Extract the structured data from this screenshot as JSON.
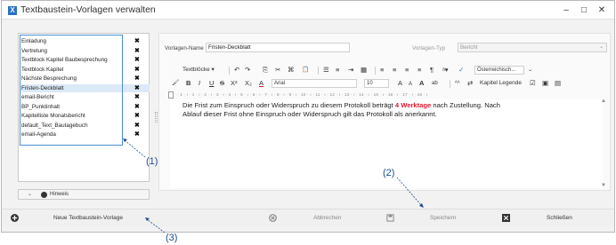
{
  "window": {
    "title": "Textbaustein-Vorlagen verwalten",
    "app_icon_letter": "X",
    "minimize": "–",
    "maximize": "□",
    "close": "✕"
  },
  "templates": {
    "items": [
      {
        "name": "Einladung",
        "delete": "✖"
      },
      {
        "name": "Vertretung",
        "delete": "✖"
      },
      {
        "name": "Textblock Kapitel Baubesprechung",
        "delete": "✖"
      },
      {
        "name": "Textblock Kapitel",
        "delete": "✖"
      },
      {
        "name": "Nächste Besprechung",
        "delete": "✖"
      },
      {
        "name": "Fristen-Deckblatt",
        "delete": "✖"
      },
      {
        "name": "email-Bericht",
        "delete": "✖"
      },
      {
        "name": "BP_Punktinhalt",
        "delete": "✖"
      },
      {
        "name": "Kapitelliste Monatsbericht",
        "delete": "✖"
      },
      {
        "name": "default_Text_Bautagebuch",
        "delete": "✖"
      },
      {
        "name": "email-Agenda",
        "delete": "✖"
      }
    ],
    "selected_index": 5
  },
  "hint": {
    "chevron": "⌄",
    "label": "Hinweis"
  },
  "form": {
    "name_label": "Vorlagen-Name",
    "name_value": "Fristen-Deckblatt",
    "type_label": "Vorlagen-Typ",
    "type_value": "Bericht",
    "type_caret": "⌄"
  },
  "toolbar": {
    "textbloecke": "Textblöcke ▾",
    "undo": "↶",
    "redo": "↷",
    "copy": "⎘",
    "cut": "✂",
    "paste_special": "⌘",
    "paste": "📋",
    "bullets": "☰",
    "numbering": "≡",
    "indent": "⇥",
    "table": "▦",
    "align_left": "≡",
    "align_center": "≡",
    "align_right": "≡",
    "justify": "≡",
    "pilcrow": "¶",
    "styles": "ᵃ▾",
    "spell": "✓",
    "language": "Österreichisch...",
    "format_painter": "🖌",
    "bold": "B",
    "italic": "I",
    "underline": "U",
    "strike": "S",
    "superscript": "X²",
    "subscript": "X₂",
    "font_color": "A",
    "font": "Arial",
    "font_size": "10",
    "grow": "A",
    "shrink": "A",
    "change_case": "A",
    "highlight": "ab",
    "find": "ᴬᴬ",
    "replace": "⇄",
    "caption_label": "Kapitel Legende",
    "checkbox": "☑",
    "image": "▣",
    "insert": "▤",
    "more": "⌄"
  },
  "ruler": {
    "text": "· 1 · ı · 1 · ı · 2 · ı · 3 · ı · 4 · ı · 5 · ı · 6 · ı · 7 · ı · 8 · ı · 9 · ı · 10 · ı · 11 · ı · 12 · ı · 13 · ı · 14 · ı · 15 · ı · 16 · ı · 17 · ı · 18 · ı"
  },
  "editor": {
    "line1_before": "Die Frist zum Einspruch oder Widerspruch zu diesem Protokoll beträgt ",
    "line1_highlight": "4 Werktage",
    "line1_after": " nach Zustellung. Nach",
    "line2": "Ablauf dieser Frist ohne Einspruch oder Widerspruch gilt das Protokoll als anerkannt."
  },
  "footer": {
    "new_template": "Neue Textbaustein-Vorlage",
    "cancel": "Abbrechen",
    "save": "Speichern",
    "close": "Schließen"
  },
  "annotations": {
    "one": "(1)",
    "two": "(2)",
    "three": "(3)"
  },
  "colors": {
    "accent": "#2a6fc9",
    "highlight_text": "#e0192d",
    "annotation": "#1c4d8c"
  }
}
